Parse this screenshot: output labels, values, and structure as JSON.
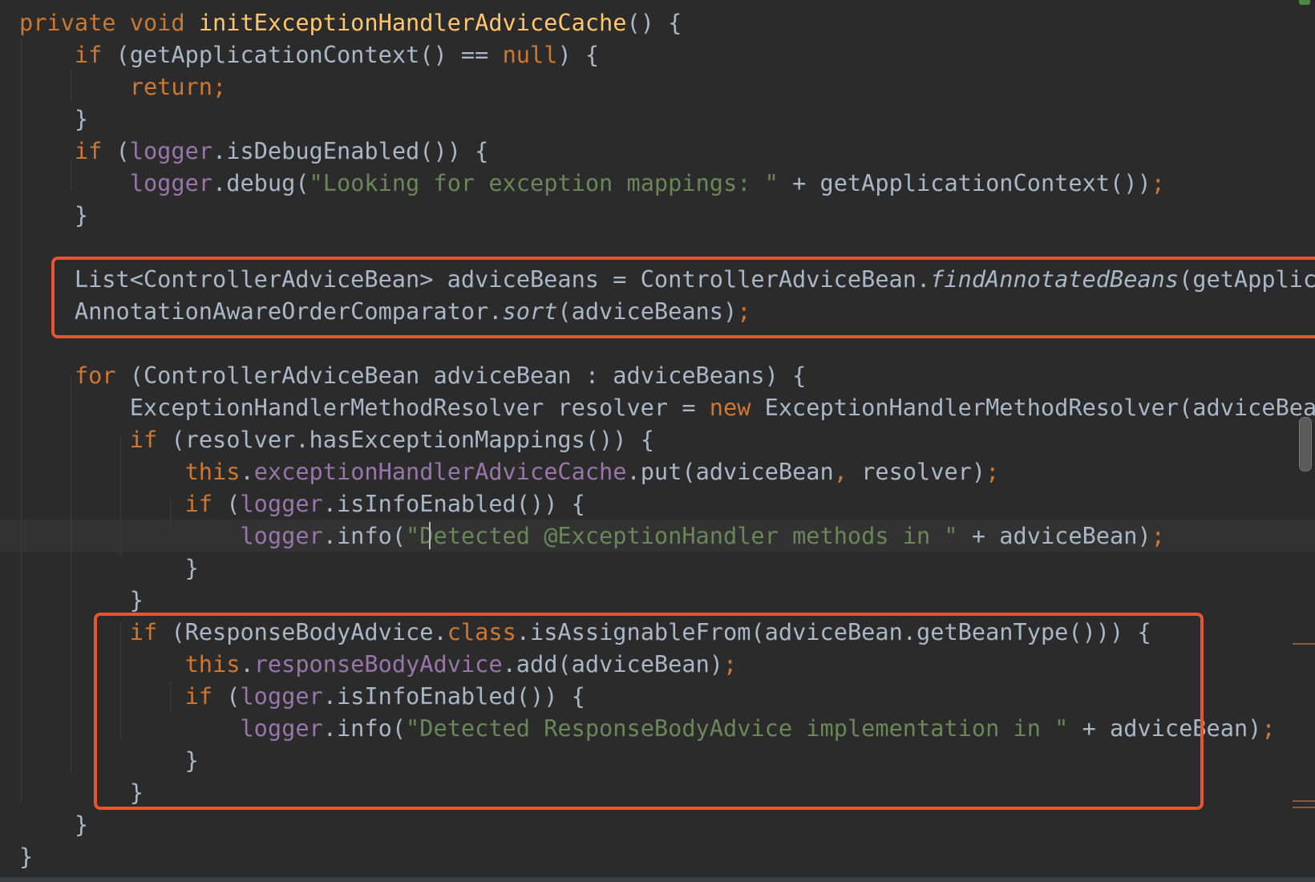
{
  "editor": {
    "lines": [
      {
        "tokens": [
          {
            "t": "private ",
            "c": "kw"
          },
          {
            "t": "void ",
            "c": "kw"
          },
          {
            "t": "initExceptionHandlerAdviceCache",
            "c": "fn"
          },
          {
            "t": "() {",
            "c": "plain"
          }
        ]
      },
      {
        "tokens": [
          {
            "t": "    ",
            "c": "plain"
          },
          {
            "t": "if ",
            "c": "kw"
          },
          {
            "t": "(getApplicationContext() == ",
            "c": "plain"
          },
          {
            "t": "null",
            "c": "kw"
          },
          {
            "t": ") {",
            "c": "plain"
          }
        ]
      },
      {
        "tokens": [
          {
            "t": "        ",
            "c": "plain"
          },
          {
            "t": "return;",
            "c": "kw"
          }
        ]
      },
      {
        "tokens": [
          {
            "t": "    }",
            "c": "plain"
          }
        ]
      },
      {
        "tokens": [
          {
            "t": "    ",
            "c": "plain"
          },
          {
            "t": "if ",
            "c": "kw"
          },
          {
            "t": "(",
            "c": "plain"
          },
          {
            "t": "logger",
            "c": "fld"
          },
          {
            "t": ".isDebugEnabled()) {",
            "c": "plain"
          }
        ]
      },
      {
        "tokens": [
          {
            "t": "        ",
            "c": "plain"
          },
          {
            "t": "logger",
            "c": "fld"
          },
          {
            "t": ".debug(",
            "c": "plain"
          },
          {
            "t": "\"Looking for exception mappings: \"",
            "c": "str"
          },
          {
            "t": " + getApplicationContext())",
            "c": "plain"
          },
          {
            "t": ";",
            "c": "kw"
          }
        ]
      },
      {
        "tokens": [
          {
            "t": "    }",
            "c": "plain"
          }
        ]
      },
      {
        "tokens": []
      },
      {
        "tokens": [
          {
            "t": "    List<ControllerAdviceBean> adviceBeans = ControllerAdviceBean.",
            "c": "plain"
          },
          {
            "t": "findAnnotatedBeans",
            "c": "it"
          },
          {
            "t": "(getApplicationCo",
            "c": "plain"
          }
        ]
      },
      {
        "tokens": [
          {
            "t": "    AnnotationAwareOrderComparator.",
            "c": "plain"
          },
          {
            "t": "sort",
            "c": "it"
          },
          {
            "t": "(adviceBeans)",
            "c": "plain"
          },
          {
            "t": ";",
            "c": "kw"
          }
        ]
      },
      {
        "tokens": []
      },
      {
        "tokens": [
          {
            "t": "    ",
            "c": "plain"
          },
          {
            "t": "for ",
            "c": "kw"
          },
          {
            "t": "(ControllerAdviceBean adviceBean : adviceBeans) {",
            "c": "plain"
          }
        ]
      },
      {
        "tokens": [
          {
            "t": "        ExceptionHandlerMethodResolver resolver = ",
            "c": "plain"
          },
          {
            "t": "new ",
            "c": "kw"
          },
          {
            "t": "ExceptionHandlerMethodResolver(adviceBean.getBe",
            "c": "plain"
          }
        ]
      },
      {
        "tokens": [
          {
            "t": "        ",
            "c": "plain"
          },
          {
            "t": "if ",
            "c": "kw"
          },
          {
            "t": "(resolver.hasExceptionMappings()) {",
            "c": "plain"
          }
        ]
      },
      {
        "tokens": [
          {
            "t": "            ",
            "c": "plain"
          },
          {
            "t": "this",
            "c": "kw"
          },
          {
            "t": ".",
            "c": "plain"
          },
          {
            "t": "exceptionHandlerAdviceCache",
            "c": "fld"
          },
          {
            "t": ".put(adviceBean",
            "c": "plain"
          },
          {
            "t": ", ",
            "c": "kw"
          },
          {
            "t": "resolver)",
            "c": "plain"
          },
          {
            "t": ";",
            "c": "kw"
          }
        ]
      },
      {
        "tokens": [
          {
            "t": "            ",
            "c": "plain"
          },
          {
            "t": "if ",
            "c": "kw"
          },
          {
            "t": "(",
            "c": "plain"
          },
          {
            "t": "logger",
            "c": "fld"
          },
          {
            "t": ".isInfoEnabled()) {",
            "c": "plain"
          }
        ]
      },
      {
        "tokens": [
          {
            "t": "                ",
            "c": "plain"
          },
          {
            "t": "logger",
            "c": "fld"
          },
          {
            "t": ".info(",
            "c": "plain"
          },
          {
            "t": "\"Detected @ExceptionHandler methods in \"",
            "c": "str"
          },
          {
            "t": " + adviceBean)",
            "c": "plain"
          },
          {
            "t": ";",
            "c": "kw"
          }
        ]
      },
      {
        "tokens": [
          {
            "t": "            }",
            "c": "plain"
          }
        ]
      },
      {
        "tokens": [
          {
            "t": "        }",
            "c": "plain"
          }
        ]
      },
      {
        "tokens": [
          {
            "t": "        ",
            "c": "plain"
          },
          {
            "t": "if ",
            "c": "kw"
          },
          {
            "t": "(ResponseBodyAdvice.",
            "c": "plain"
          },
          {
            "t": "class",
            "c": "kw"
          },
          {
            "t": ".isAssignableFrom(adviceBean.getBeanType())) {",
            "c": "plain"
          }
        ]
      },
      {
        "tokens": [
          {
            "t": "            ",
            "c": "plain"
          },
          {
            "t": "this",
            "c": "kw"
          },
          {
            "t": ".",
            "c": "plain"
          },
          {
            "t": "responseBodyAdvice",
            "c": "fld"
          },
          {
            "t": ".add(adviceBean)",
            "c": "plain"
          },
          {
            "t": ";",
            "c": "kw"
          }
        ]
      },
      {
        "tokens": [
          {
            "t": "            ",
            "c": "plain"
          },
          {
            "t": "if ",
            "c": "kw"
          },
          {
            "t": "(",
            "c": "plain"
          },
          {
            "t": "logger",
            "c": "fld"
          },
          {
            "t": ".isInfoEnabled()) {",
            "c": "plain"
          }
        ]
      },
      {
        "tokens": [
          {
            "t": "                ",
            "c": "plain"
          },
          {
            "t": "logger",
            "c": "fld"
          },
          {
            "t": ".info(",
            "c": "plain"
          },
          {
            "t": "\"Detected ResponseBodyAdvice implementation in \"",
            "c": "str"
          },
          {
            "t": " + adviceBean)",
            "c": "plain"
          },
          {
            "t": ";",
            "c": "kw"
          }
        ]
      },
      {
        "tokens": [
          {
            "t": "            }",
            "c": "plain"
          }
        ]
      },
      {
        "tokens": [
          {
            "t": "        }",
            "c": "plain"
          }
        ]
      },
      {
        "tokens": [
          {
            "t": "    }",
            "c": "plain"
          }
        ]
      },
      {
        "tokens": [
          {
            "t": "}",
            "c": "plain"
          }
        ]
      }
    ]
  }
}
